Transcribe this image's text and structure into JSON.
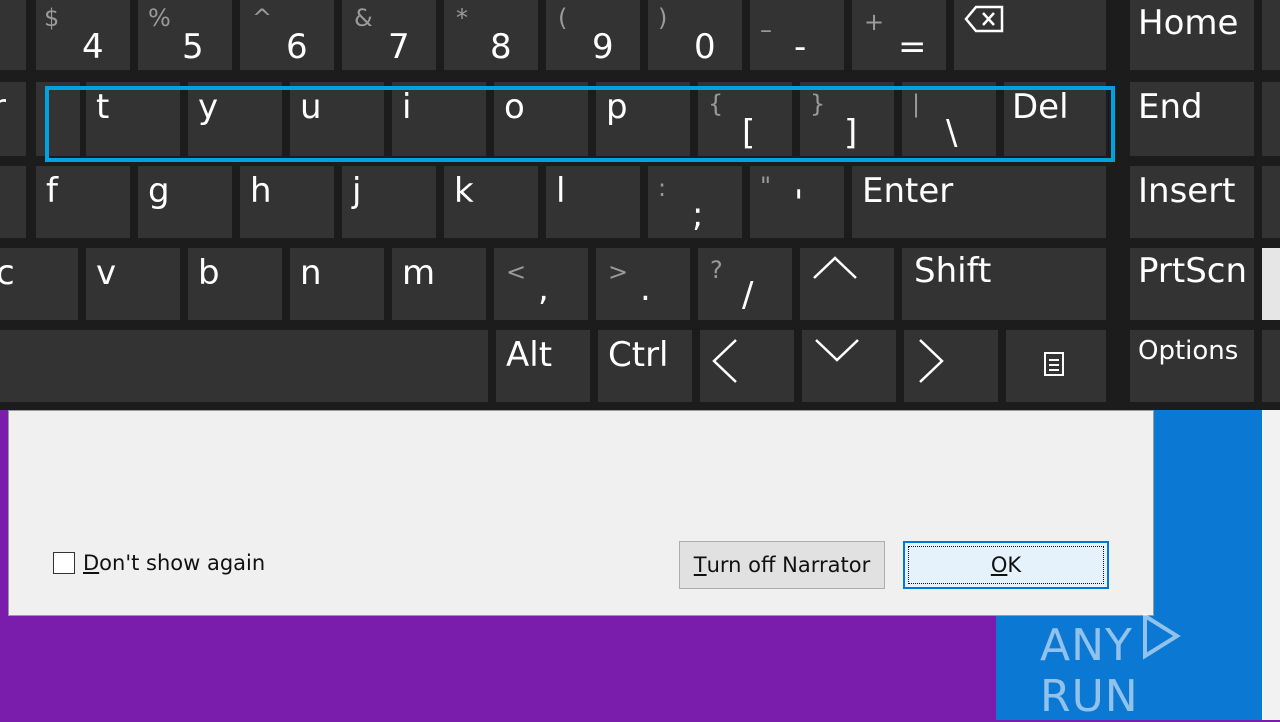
{
  "keyboard": {
    "row_numbers": [
      {
        "shift": "$",
        "main": "4"
      },
      {
        "shift": "%",
        "main": "5"
      },
      {
        "shift": "^",
        "main": "6"
      },
      {
        "shift": "&",
        "main": "7"
      },
      {
        "shift": "*",
        "main": "8"
      },
      {
        "shift": "(",
        "main": "9"
      },
      {
        "shift": ")",
        "main": "0"
      },
      {
        "shift": "–",
        "main": "-"
      },
      {
        "shift": "+",
        "main": "="
      }
    ],
    "home": "Home",
    "row_top": [
      "r",
      "t",
      "y",
      "u",
      "i",
      "o",
      "p"
    ],
    "brackets": [
      {
        "shift": "{",
        "main": "["
      },
      {
        "shift": "}",
        "main": "]"
      },
      {
        "shift": "|",
        "main": "\\"
      }
    ],
    "del": "Del",
    "end": "End",
    "row_home": [
      "f",
      "g",
      "h",
      "j",
      "k",
      "l"
    ],
    "semicolon": {
      "shift": ":",
      "main": ";"
    },
    "quote": {
      "shift": "\"",
      "main": "'"
    },
    "enter": "Enter",
    "insert": "Insert",
    "row_bottom": [
      "c",
      "v",
      "b",
      "n",
      "m"
    ],
    "comma": {
      "shift": "<",
      "main": ","
    },
    "period": {
      "shift": ">",
      "main": "."
    },
    "slash": {
      "shift": "?",
      "main": "/"
    },
    "shift": "Shift",
    "prtscn": "PrtScn",
    "alt": "Alt",
    "ctrl": "Ctrl",
    "options": "Options"
  },
  "dialog": {
    "checkbox_label_access": "D",
    "checkbox_label_rest": "on't show again",
    "turn_off_access": "T",
    "turn_off_rest": "urn off Narrator",
    "ok_access": "O",
    "ok_rest": "K"
  },
  "watermark": {
    "left": "ANY",
    "right": "RUN"
  },
  "colors": {
    "highlight": "#00a2e0",
    "purple": "#7a1cac",
    "blue": "#0b78d4"
  }
}
